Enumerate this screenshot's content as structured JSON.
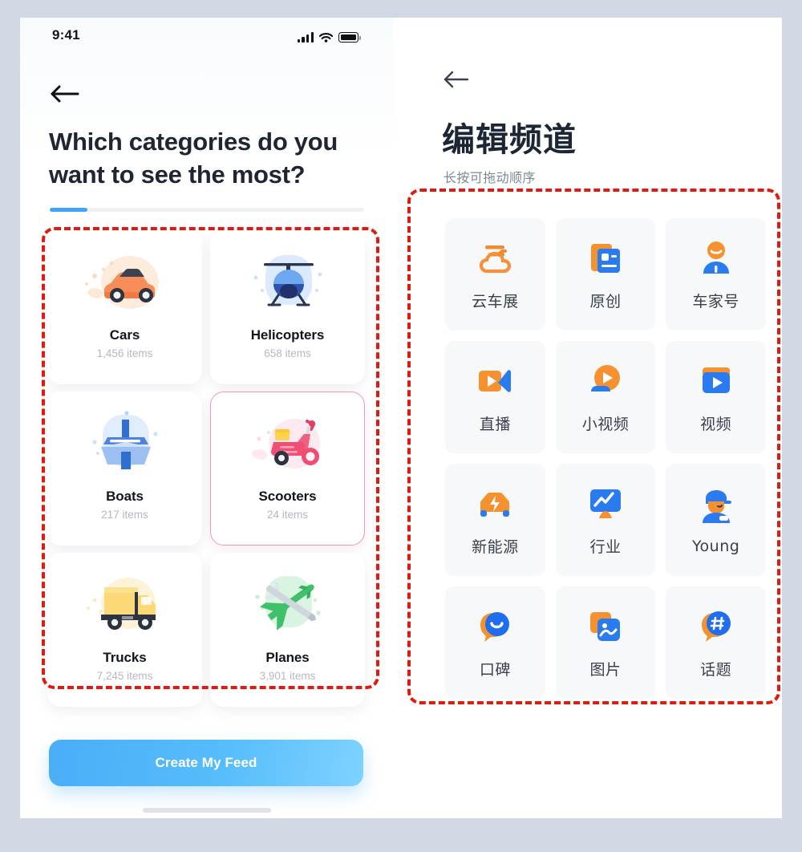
{
  "left_screen": {
    "status_bar": {
      "time": "9:41",
      "signal_icon": "cellular-signal-icon",
      "wifi_icon": "wifi-icon",
      "battery_icon": "battery-full-icon"
    },
    "back_icon": "back-arrow-icon",
    "title": "Which categories do you want to see the most?",
    "progress": {
      "percent": 12
    },
    "categories": [
      {
        "name": "Cars",
        "items": "1,456 items",
        "icon": "car-icon",
        "selected": false
      },
      {
        "name": "Helicopters",
        "items": "658 items",
        "icon": "helicopter-icon",
        "selected": false
      },
      {
        "name": "Boats",
        "items": "217 items",
        "icon": "boat-icon",
        "selected": false
      },
      {
        "name": "Scooters",
        "items": "24 items",
        "icon": "scooter-icon",
        "selected": true
      },
      {
        "name": "Trucks",
        "items": "7,245 items",
        "icon": "truck-icon",
        "selected": false
      },
      {
        "name": "Planes",
        "items": "3,901 items",
        "icon": "plane-icon",
        "selected": false
      }
    ],
    "cta_label": "Create My Feed",
    "home_indicator": "home-indicator"
  },
  "right_screen": {
    "back_icon": "back-arrow-icon",
    "title": "编辑频道",
    "subtitle": "长按可拖动顺序",
    "channels": [
      {
        "label": "云车展",
        "icon": "cloud-auto-show-icon"
      },
      {
        "label": "原创",
        "icon": "original-article-icon"
      },
      {
        "label": "车家号",
        "icon": "user-account-icon"
      },
      {
        "label": "直播",
        "icon": "live-stream-icon"
      },
      {
        "label": "小视频",
        "icon": "short-video-icon"
      },
      {
        "label": "视频",
        "icon": "video-icon"
      },
      {
        "label": "新能源",
        "icon": "electric-vehicle-icon"
      },
      {
        "label": "行业",
        "icon": "industry-chart-icon"
      },
      {
        "label": "Young",
        "icon": "young-person-icon"
      },
      {
        "label": "口碑",
        "icon": "reputation-bubble-icon"
      },
      {
        "label": "图片",
        "icon": "photo-icon"
      },
      {
        "label": "话题",
        "icon": "hashtag-topic-icon"
      }
    ]
  },
  "annotations": {
    "color": "#e01b0e",
    "boxes": [
      {
        "name": "left-category-grid-highlight"
      },
      {
        "name": "right-channel-grid-highlight"
      }
    ]
  },
  "theme": {
    "page_background": "#d2d7e4",
    "accent_blue": "#41a4f5",
    "selected_border": "#e79bb8",
    "tile_background": "#f7f8fa"
  }
}
